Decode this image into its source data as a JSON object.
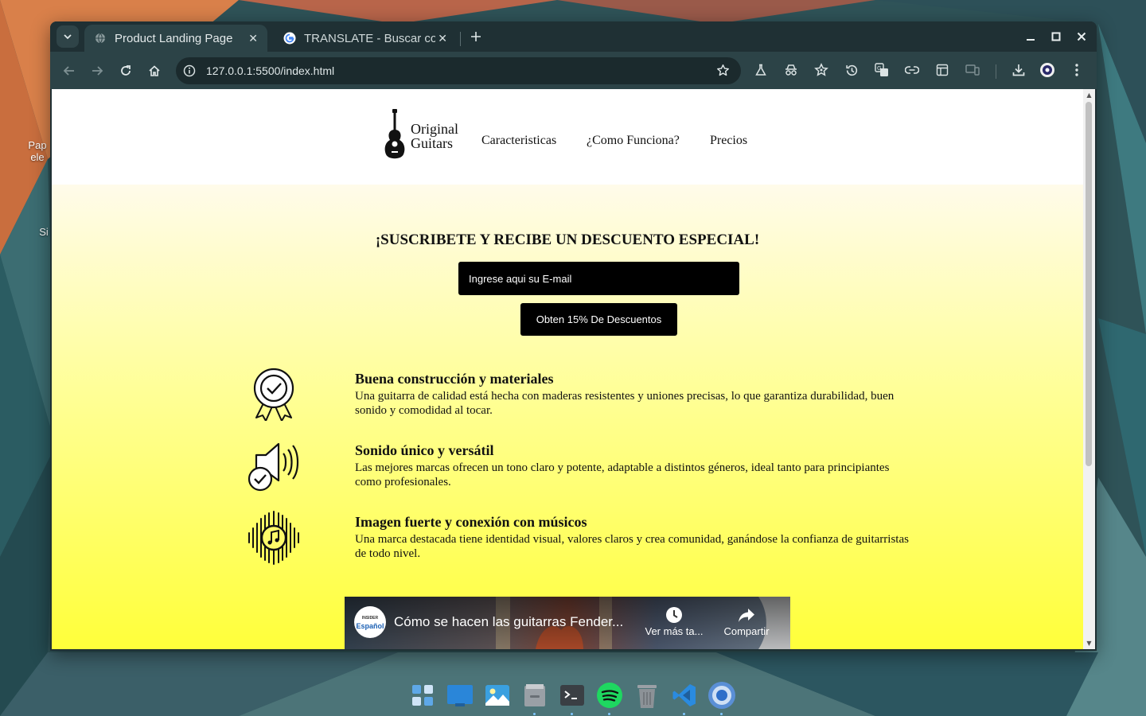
{
  "desktop": {
    "icons": [
      {
        "label_line1": "Pap",
        "label_line2": "ele"
      },
      {
        "label_line1": "Si",
        "label_line2": ""
      }
    ]
  },
  "browser": {
    "tabs": [
      {
        "title": "Product Landing Page",
        "favicon": "globe-icon",
        "active": true
      },
      {
        "title": "TRANSLATE - Buscar con",
        "favicon": "google-icon",
        "active": false
      }
    ],
    "url": "127.0.0.1:5500/index.html"
  },
  "site": {
    "logo_line1": "Original",
    "logo_line2": "Guitars",
    "nav": [
      "Caracteristicas",
      "¿Como Funciona?",
      "Precios"
    ],
    "hero_title": "¡SUSCRIBETE Y RECIBE UN DESCUENTO ESPECIAL!",
    "email_placeholder": "Ingrese aqui su E-mail",
    "cta_label": "Obten 15% De Descuentos",
    "features": [
      {
        "icon": "award-ribbon-icon",
        "title": "Buena construcción y materiales",
        "description": "Una guitarra de calidad está hecha con maderas resistentes y uniones precisas, lo que garantiza durabilidad, buen sonido y comodidad al tocar."
      },
      {
        "icon": "speaker-check-icon",
        "title": "Sonido único y versátil",
        "description": "Las mejores marcas ofrecen un tono claro y potente, adaptable a distintos géneros, ideal tanto para principiantes como profesionales."
      },
      {
        "icon": "music-note-soundwave-icon",
        "title": "Imagen fuerte y conexión con músicos",
        "description": "Una marca destacada tiene identidad visual, valores claros y crea comunidad, ganándose la confianza de guitarristas de todo nivel."
      }
    ],
    "video": {
      "channel_line1": "INSIDER",
      "channel_line2": "Español",
      "title": "Cómo se hacen las guitarras Fender...",
      "watch_later": "Ver más ta...",
      "share": "Compartir"
    }
  },
  "dock": [
    "app-grid-icon",
    "desktop-icon",
    "photos-icon",
    "files-icon",
    "terminal-icon",
    "spotify-icon",
    "trash-icon",
    "vscode-icon",
    "chrome-icon"
  ]
}
